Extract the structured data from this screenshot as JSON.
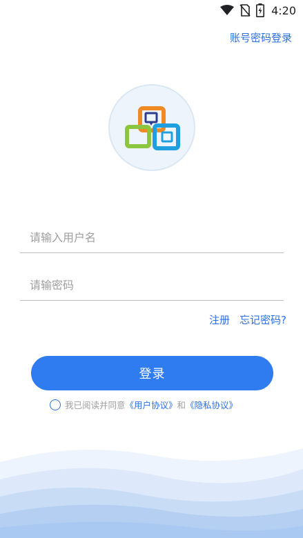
{
  "status_bar": {
    "time": "4:20",
    "icons": [
      "wifi-icon",
      "no-sim-icon",
      "battery-charging-icon"
    ]
  },
  "header": {
    "account_password_login": "账号密码登录"
  },
  "logo": {
    "icon": "app-logo-icon",
    "colors": {
      "orange": "#f08a24",
      "navy": "#2c3d8f",
      "green": "#8cc63f",
      "blue": "#1ea0e0"
    }
  },
  "form": {
    "username_placeholder": "请输入用户名",
    "username_value": "",
    "password_placeholder": "请输密码",
    "password_value": ""
  },
  "links": {
    "register": "注册",
    "forgot_password": "忘记密码?"
  },
  "login_button": {
    "label": "登录"
  },
  "agreement": {
    "prefix": "我已阅读并同意",
    "user_agreement": "《用户协议》",
    "and": "和",
    "privacy_agreement": "《隐私协议》",
    "checked": false
  },
  "colors": {
    "accent": "#2b6fe0",
    "button": "#2f7bf0",
    "wave_light": "#e8f1fc",
    "wave_dark": "#a9c9f2"
  }
}
